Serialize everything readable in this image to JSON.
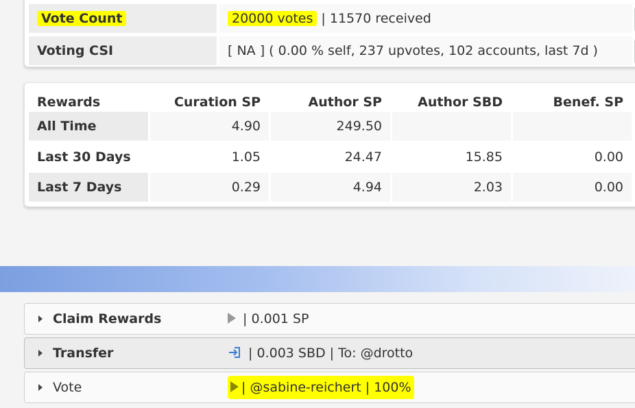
{
  "summary": {
    "vote_count_label": "Vote Count",
    "vote_count_value": "20000 votes",
    "vote_count_received": " | 11570 received",
    "voting_csi_label": "Voting CSI",
    "voting_csi_value": "[ NA ] ( 0.00 % self, 237 upvotes, 102 accounts, last 7d )"
  },
  "rewards": {
    "headers": [
      "Rewards",
      "Curation SP",
      "Author SP",
      "Author SBD",
      "Benef. SP"
    ],
    "rows": [
      {
        "label": "All Time",
        "curation_sp": "4.90",
        "author_sp": "249.50",
        "author_sbd": "",
        "benef_sp": ""
      },
      {
        "label": "Last 30 Days",
        "curation_sp": "1.05",
        "author_sp": "24.47",
        "author_sbd": "15.85",
        "benef_sp": "0.00"
      },
      {
        "label": "Last 7 Days",
        "curation_sp": "0.29",
        "author_sp": "4.94",
        "author_sbd": "2.03",
        "benef_sp": "0.00"
      }
    ]
  },
  "operations": [
    {
      "name": "Claim Rewards",
      "icon": "play-icon",
      "detail": "| 0.001 SP"
    },
    {
      "name": "Transfer",
      "icon": "transfer-in-icon",
      "detail": "| 0.003 SBD | To: @drotto"
    },
    {
      "name": "Vote",
      "icon": "play-icon",
      "detail": "| @sabine-reichert | 100%"
    }
  ],
  "colors": {
    "highlight": "#ffff00",
    "banner_start": "#7b9fe0",
    "banner_end": "#eef2fb"
  }
}
